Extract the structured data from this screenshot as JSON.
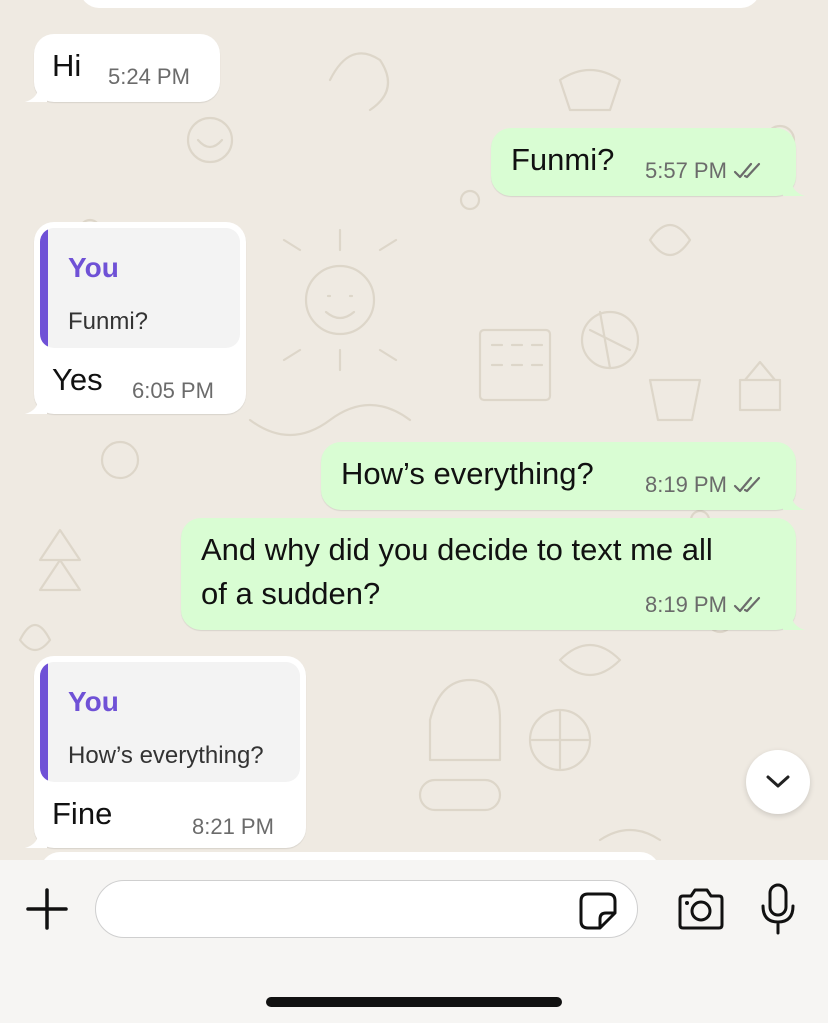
{
  "messages": [
    {
      "direction": "incoming",
      "text": "Hi",
      "time": "5:24 PM"
    },
    {
      "direction": "outgoing",
      "text": "Funmi?",
      "time": "5:57 PM",
      "status": "read"
    },
    {
      "direction": "incoming",
      "quote": {
        "author": "You",
        "text": "Funmi?"
      },
      "text": "Yes",
      "time": "6:05 PM"
    },
    {
      "direction": "outgoing",
      "text": "How’s everything?",
      "time": "8:19 PM",
      "status": "read"
    },
    {
      "direction": "outgoing",
      "text": "And why did you decide to text me all\nof a sudden?",
      "time": "8:19 PM",
      "status": "read"
    },
    {
      "direction": "incoming",
      "quote": {
        "author": "You",
        "text": "How’s everything?"
      },
      "text": "Fine",
      "time": "8:21 PM"
    }
  ],
  "composer": {
    "input_value": "",
    "icons": [
      "plus-icon",
      "sticker-icon",
      "camera-icon",
      "microphone-icon"
    ]
  },
  "scroll_button_icon": "chevron-down-icon",
  "colors": {
    "incoming_bubble": "#ffffff",
    "outgoing_bubble": "#d9fdd3",
    "quote_accent": "#6f51d6",
    "wallpaper": "#efeae2",
    "read_ticks": "#6b6b6b"
  }
}
